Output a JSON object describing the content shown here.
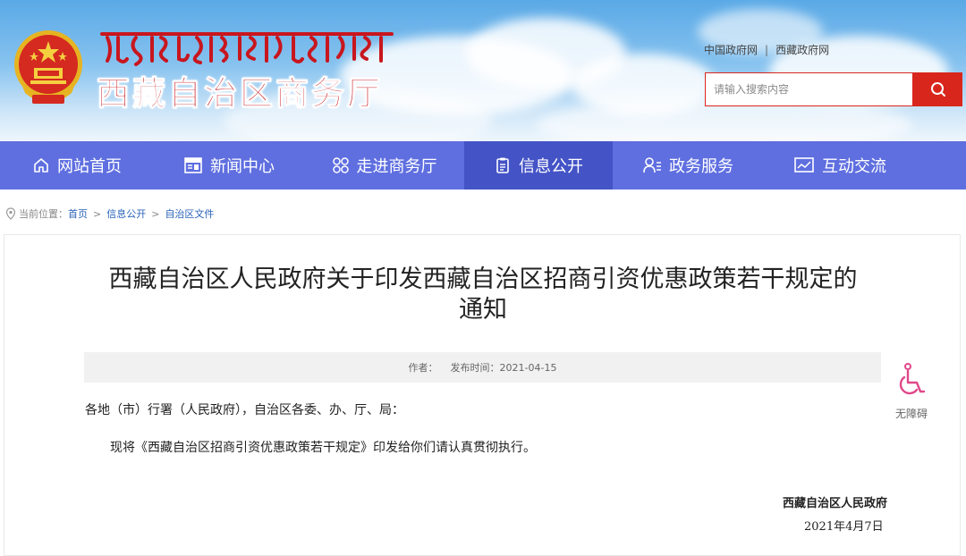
{
  "header": {
    "site_title": "西藏自治区商务厅",
    "tibetan_title": "བོད་རང་སྐྱོང་ལྗོངས་ཚོང་དོན་ཁང་།",
    "top_links": [
      "中国政府网",
      "西藏政府网"
    ],
    "search": {
      "placeholder": "请输入搜索内容",
      "value": ""
    }
  },
  "nav": {
    "items": [
      {
        "label": "网站首页",
        "icon": "home-icon"
      },
      {
        "label": "新闻中心",
        "icon": "news-icon"
      },
      {
        "label": "走进商务厅",
        "icon": "grid-icon"
      },
      {
        "label": "信息公开",
        "icon": "clipboard-icon",
        "active": true
      },
      {
        "label": "政务服务",
        "icon": "user-service-icon"
      },
      {
        "label": "互动交流",
        "icon": "chart-screen-icon"
      }
    ]
  },
  "breadcrumb": {
    "prefix": "当前位置：",
    "items": [
      "首页",
      "信息公开",
      "自治区文件"
    ]
  },
  "article": {
    "title": "西藏自治区人民政府关于印发西藏自治区招商引资优惠政策若干规定的通知",
    "author_label": "作者：",
    "author": "",
    "date_label": "发布时间：",
    "publish_date": "2021-04-15",
    "salutation": "各地（市）行署（人民政府），自治区各委、办、厅、局：",
    "body": "现将《西藏自治区招商引资优惠政策若干规定》印发给你们请认真贯彻执行。",
    "signature": "西藏自治区人民政府",
    "sign_date": "2021年4月7日"
  },
  "accessibility": {
    "label": "无障碍"
  },
  "colors": {
    "nav_bg": "#5f6fe0",
    "nav_active": "#4453c6",
    "brand_red": "#d9261c",
    "link_blue": "#2962b8"
  }
}
